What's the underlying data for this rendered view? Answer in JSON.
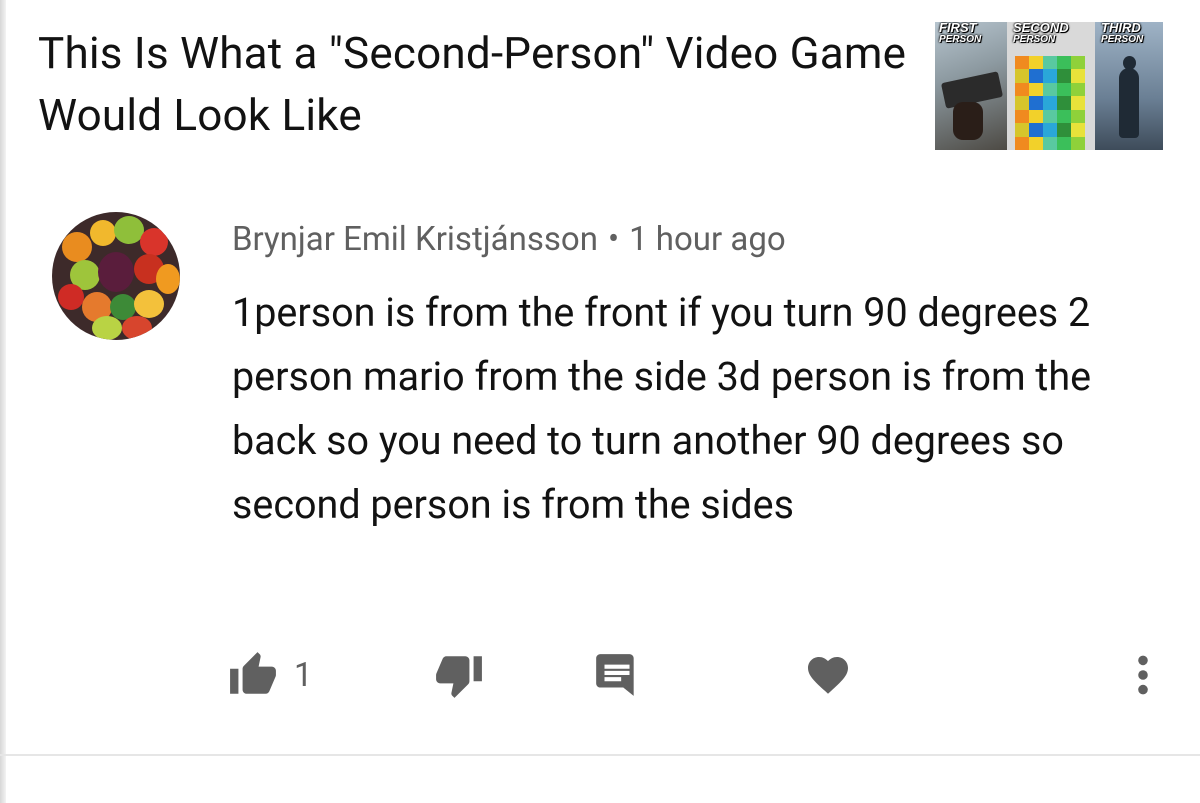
{
  "video": {
    "title": "This Is What a \"Second-Person\" Video Game Would Look Like",
    "thumbnail": {
      "labels": [
        {
          "top": "FIRST",
          "bottom": "PERSON"
        },
        {
          "top": "SECOND",
          "bottom": "PERSON"
        },
        {
          "top": "THIRD",
          "bottom": "PERSON"
        }
      ]
    }
  },
  "comment": {
    "author": "Brynjar Emil Kristjánsson",
    "separator": "•",
    "time": "1 hour ago",
    "text": "1person is from the front if you turn 90 degrees 2 person mario from the side 3d person is from the back so you need to turn another 90 degrees so second person is from the sides",
    "likes": "1"
  },
  "icons": {
    "like": "thumbs-up-icon",
    "dislike": "thumbs-down-icon",
    "reply": "reply-comment-icon",
    "heart": "heart-icon",
    "more": "more-vertical-icon"
  },
  "colors": {
    "icon": "#606060",
    "text": "#121212",
    "meta": "#606060"
  }
}
